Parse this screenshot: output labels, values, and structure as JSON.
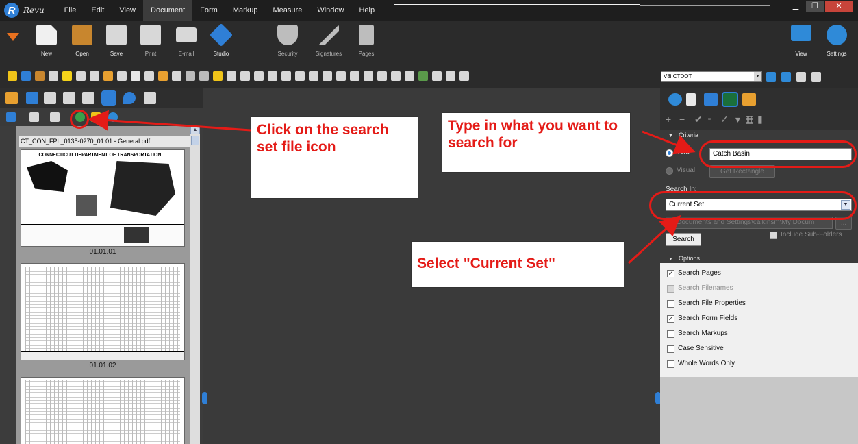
{
  "app": {
    "brand": "Revu"
  },
  "menu": [
    "File",
    "Edit",
    "View",
    "Document",
    "Form",
    "Markup",
    "Measure",
    "Window",
    "Help"
  ],
  "window_controls": {
    "minimize": "▁",
    "maximize": "❐",
    "close": "✕"
  },
  "ribbon": {
    "left": [
      {
        "label": "New",
        "color": "#f0f0f0"
      },
      {
        "label": "Open",
        "color": "#c8862e"
      },
      {
        "label": "Save",
        "color": "#d8d8d8"
      },
      {
        "label": "Print",
        "color": "#d8d8d8"
      },
      {
        "label": "E-mail",
        "color": "#d8d8d8"
      },
      {
        "label": "Studio",
        "color": "#2f7fd6"
      },
      {
        "label": "Security",
        "color": "#bdbdbd"
      },
      {
        "label": "Signatures",
        "color": "#bdbdbd"
      },
      {
        "label": "Pages",
        "color": "#bdbdbd"
      }
    ],
    "right": [
      {
        "label": "View",
        "color": "#2f8ad8"
      },
      {
        "label": "Settings",
        "color": "#2f8ad8"
      }
    ]
  },
  "toolbar": {
    "style_combo": "V8i CTDOT"
  },
  "left_panel": {
    "file_name": "CT_CON_FPL_0135-0270_01.01 - General.pdf",
    "page1_title": "CONNECTICUT DEPARTMENT OF TRANSPORTATION",
    "pages": [
      "01.01.01",
      "01.01.02"
    ]
  },
  "search_panel": {
    "criteria_header": "Criteria",
    "text_label": "Text",
    "text_value": "Catch Basin",
    "visual_label": "Visual",
    "get_rectangle": "Get Rectangle",
    "search_in_label": "Search In:",
    "search_in_value": "Current Set",
    "path_value": "d:\\Documents and Settings\\calkinsm\\My Docum",
    "browse": "...",
    "search_button": "Search",
    "include_subfolders": "Include Sub-Folders",
    "options_header": "Options",
    "options": [
      {
        "label": "Search Pages",
        "checked": true,
        "enabled": true
      },
      {
        "label": "Search Filenames",
        "checked": false,
        "enabled": false
      },
      {
        "label": "Search File Properties",
        "checked": false,
        "enabled": true
      },
      {
        "label": "Search Form Fields",
        "checked": true,
        "enabled": true
      },
      {
        "label": "Search Markups",
        "checked": false,
        "enabled": true
      },
      {
        "label": "Case Sensitive",
        "checked": false,
        "enabled": true
      },
      {
        "label": "Whole Words Only",
        "checked": false,
        "enabled": true
      }
    ]
  },
  "callouts": {
    "click_icon": "Click on the search set file icon",
    "type_search": "Type in what you want to search for",
    "select_set": "Select \"Current Set\""
  },
  "colors": {
    "annotation_red": "#e41b17",
    "accent_blue": "#2f7fd6"
  }
}
